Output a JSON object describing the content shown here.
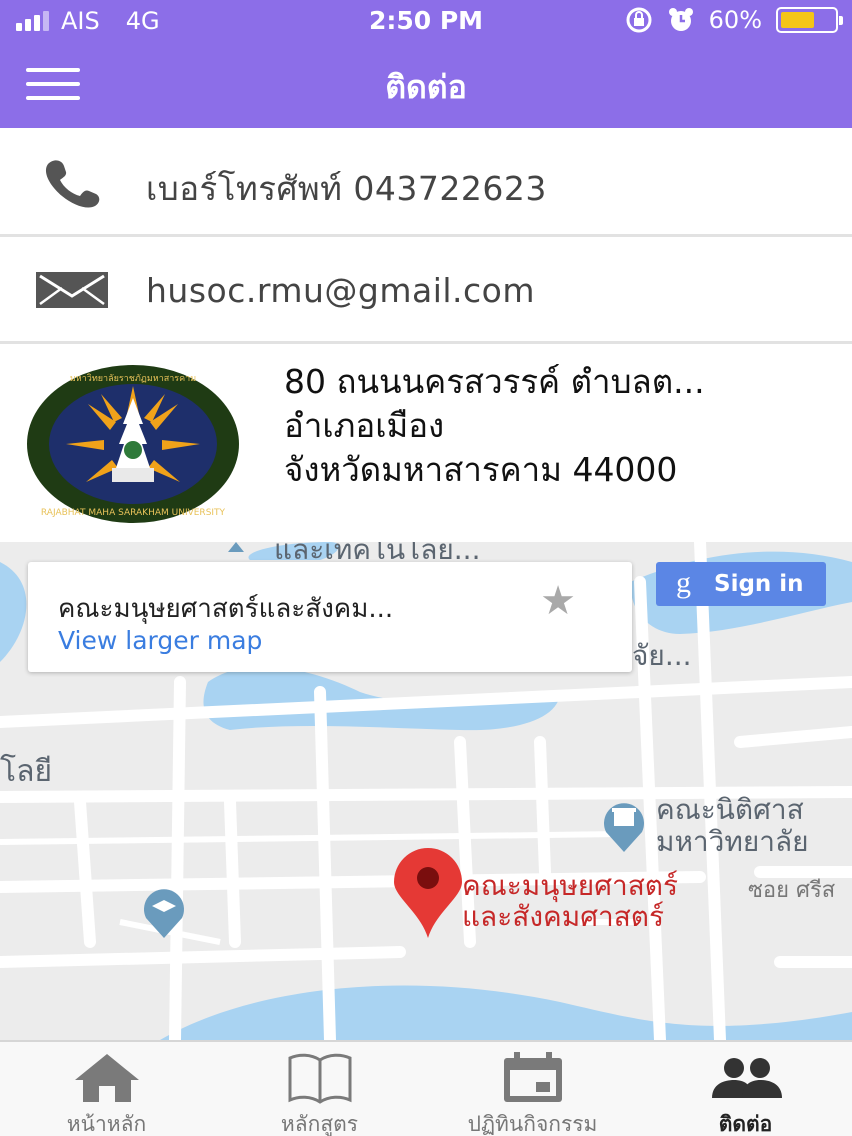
{
  "status_bar": {
    "carrier": "AIS",
    "network": "4G",
    "time": "2:50 PM",
    "battery": "60%",
    "battery_level": 0.6
  },
  "header": {
    "title": "ติดต่อ"
  },
  "contact": {
    "phone": "เบอร์โทรศัพท์ 043722623",
    "email": "husoc.rmu@gmail.com",
    "address_line1": "80 ถนนนครสวรรค์ ตำบลต...",
    "address_line2": "อำเภอเมือง",
    "address_line3": "จังหวัดมหาสารคาม 44000",
    "logo_text_top": "มหาวิทยาลัยราชภัฏมหาสารคาม",
    "logo_text_bottom": "RAJABHAT MAHA SARAKHAM UNIVERSITY"
  },
  "map": {
    "card_place": "คณะมนุษยศาสตร์และสังคม...",
    "view_larger": "View larger map",
    "sign_in": "Sign in",
    "label_top": "และเทคโนโลย...",
    "label_right_top": "จัย...",
    "label_left": "โลยี",
    "law_faculty_1": "คณะนิติศาส",
    "law_faculty_2": "มหาวิทยาลัย",
    "pin_label_1": "คณะมนุษยศาสตร์",
    "pin_label_2": "และสังคมศาสตร์",
    "road_label": "ซอย ศรีส"
  },
  "tabs": [
    {
      "label": "หน้าหลัก",
      "icon": "home-icon"
    },
    {
      "label": "หลักสูตร",
      "icon": "book-icon"
    },
    {
      "label": "ปฏิทินกิจกรรม",
      "icon": "calendar-icon"
    },
    {
      "label": "ติดต่อ",
      "icon": "people-icon"
    }
  ],
  "colors": {
    "primary": "#8c6ee8",
    "pin": "#e53935",
    "link": "#3a7de0",
    "water": "#a9d3f2"
  }
}
